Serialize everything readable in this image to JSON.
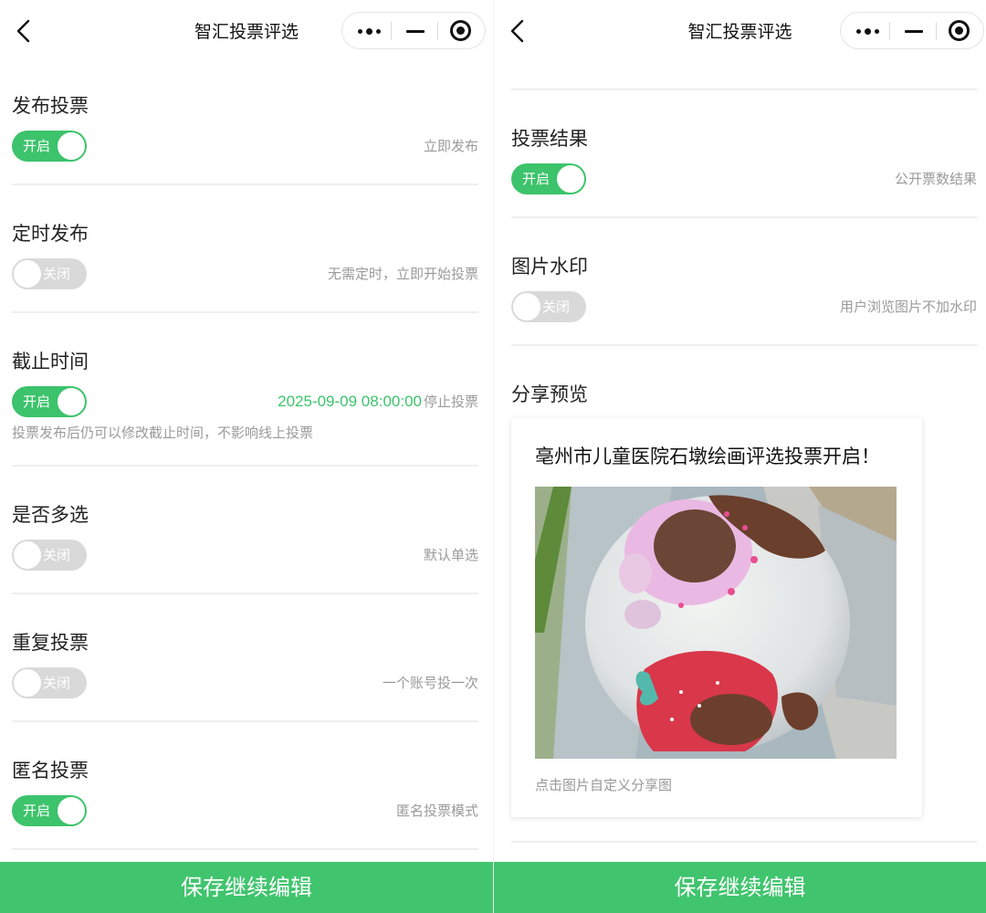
{
  "header": {
    "title": "智汇投票评选"
  },
  "left_panel": {
    "settings": [
      {
        "title": "发布投票",
        "toggle": "on",
        "toggle_label": "开启",
        "hint": "立即发布"
      },
      {
        "title": "定时发布",
        "toggle": "off",
        "toggle_label": "关闭",
        "hint": "无需定时，立即开始投票"
      },
      {
        "title": "截止时间",
        "toggle": "on",
        "toggle_label": "开启",
        "date": "2025-09-09  08:00:00",
        "hint": "停止投票",
        "note": "投票发布后仍可以修改截止时间，不影响线上投票"
      },
      {
        "title": "是否多选",
        "toggle": "off",
        "toggle_label": "关闭",
        "hint": "默认单选"
      },
      {
        "title": "重复投票",
        "toggle": "off",
        "toggle_label": "关闭",
        "hint": "一个账号投一次"
      },
      {
        "title": "匿名投票",
        "toggle": "on",
        "toggle_label": "开启",
        "hint": "匿名投票模式"
      }
    ]
  },
  "right_panel": {
    "settings": [
      {
        "title": "投票结果",
        "toggle": "on",
        "toggle_label": "开启",
        "hint": "公开票数结果"
      },
      {
        "title": "图片水印",
        "toggle": "off",
        "toggle_label": "关闭",
        "hint": "用户浏览图片不加水印"
      }
    ],
    "share": {
      "section_title": "分享预览",
      "card_title": "亳州市儿童医院石墩绘画评选投票开启！",
      "card_note": "点击图片自定义分享图"
    }
  },
  "bottom_button": "保存继续编辑",
  "colors": {
    "accent": "#3cc36b",
    "button_green": "#40c46d",
    "toggle_off": "#d9d9d9",
    "hint_gray": "#9a9a9a"
  },
  "icons": [
    "back-arrow-icon",
    "more-dots-icon",
    "minimize-icon",
    "close-target-icon"
  ]
}
